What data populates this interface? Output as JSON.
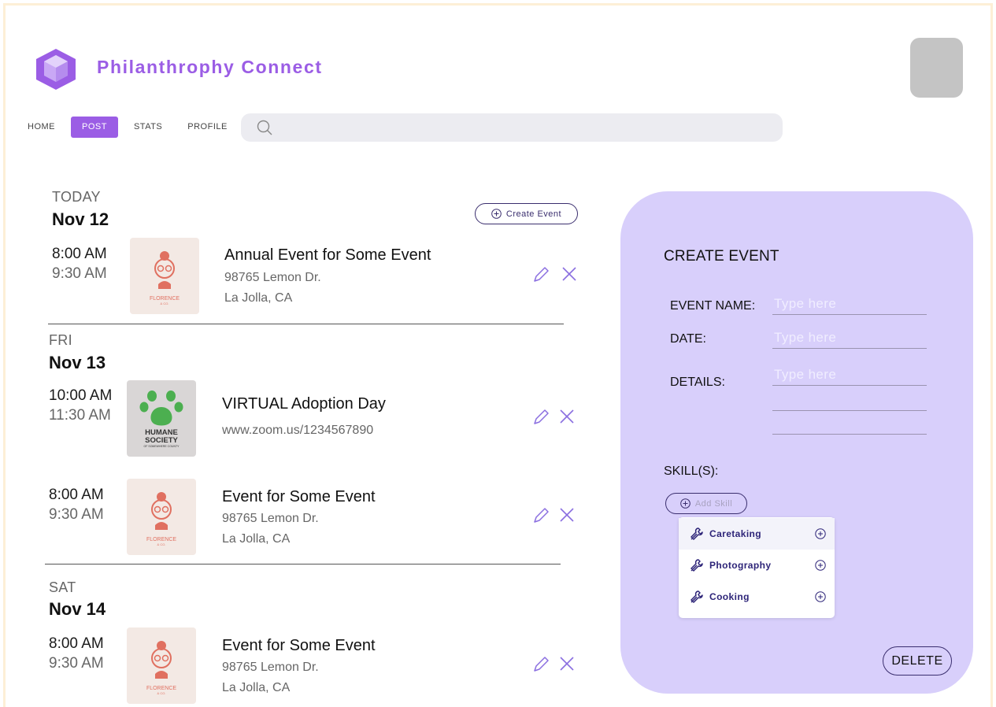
{
  "app": {
    "brand": "Philanthrophy Connect"
  },
  "nav": [
    {
      "label": "HOME"
    },
    {
      "label": "POST"
    },
    {
      "label": "STATS"
    },
    {
      "label": "PROFILE"
    }
  ],
  "search": {
    "placeholder": ""
  },
  "create_event_button": "Create Event",
  "days": [
    {
      "label": "TODAY",
      "date": "Nov 12"
    },
    {
      "label": "FRI",
      "date": "Nov 13"
    },
    {
      "label": "SAT",
      "date": "Nov 14"
    }
  ],
  "events": [
    {
      "start": "8:00 AM",
      "end": "9:30 AM",
      "title": "Annual Event for Some Event",
      "line1": "98765 Lemon Dr.",
      "line2": "La Jolla, CA",
      "logo": "FLORENCE",
      "logo_sub": "& CO."
    },
    {
      "start": "10:00 AM",
      "end": "11:30 AM",
      "title": "VIRTUAL Adoption Day",
      "line1": "www.zoom.us/1234567890",
      "line2": "",
      "logo": "HUMANE",
      "logo2": "SOCIETY",
      "logo_sub": "OF SOMEWHERE COUNTY"
    },
    {
      "start": "8:00 AM",
      "end": "9:30 AM",
      "title": "Event for Some Event",
      "line1": "98765 Lemon Dr.",
      "line2": "La Jolla, CA",
      "logo": "FLORENCE",
      "logo_sub": "& CO."
    },
    {
      "start": "8:00 AM",
      "end": "9:30 AM",
      "title": "Event for Some Event",
      "line1": "98765 Lemon Dr.",
      "line2": "La Jolla, CA",
      "logo": "FLORENCE",
      "logo_sub": "& CO."
    }
  ],
  "panel": {
    "title": "CREATE EVENT",
    "fields": [
      {
        "label": "EVENT NAME:",
        "placeholder": "Type here"
      },
      {
        "label": "DATE:",
        "placeholder": "Type here"
      },
      {
        "label": "DETAILS:",
        "placeholder": "Type here"
      }
    ],
    "skills_label": "SKILL(S):",
    "add_skill": "Add Skill",
    "skills": [
      {
        "label": "Caretaking"
      },
      {
        "label": "Photography"
      },
      {
        "label": "Cooking"
      }
    ],
    "delete": "DELETE"
  },
  "colors": {
    "accent": "#9b5de5",
    "panel": "#d8cffb",
    "dark": "#3a2e6e",
    "action": "#8a6ee0"
  }
}
